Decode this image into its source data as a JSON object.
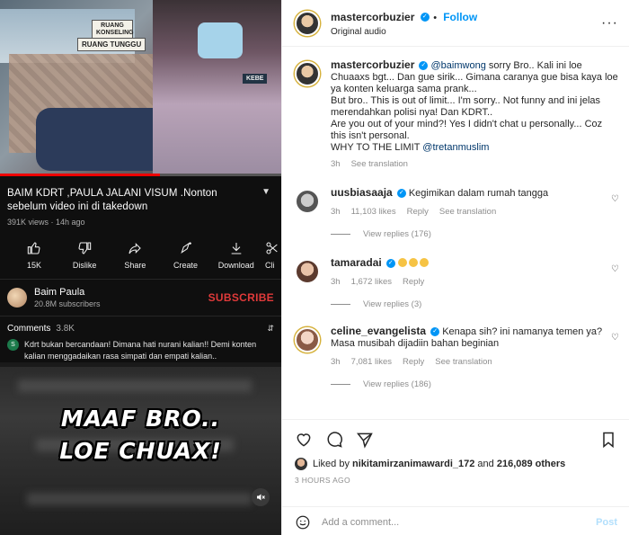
{
  "video": {
    "signs": [
      "RUANG KONSELING",
      "RUANG TUNGGU",
      "KEBE"
    ],
    "title": "BAIM KDRT ,PAULA JALANI VISUM .Nonton sebelum video ini di takedown",
    "meta": "391K views · 14h ago",
    "actions": [
      {
        "label": "15K",
        "icon": "like-icon"
      },
      {
        "label": "Dislike",
        "icon": "dislike-icon"
      },
      {
        "label": "Share",
        "icon": "share-icon"
      },
      {
        "label": "Create",
        "icon": "create-icon"
      },
      {
        "label": "Download",
        "icon": "download-icon"
      },
      {
        "label": "Cli",
        "icon": "clip-icon"
      }
    ],
    "channel": {
      "name": "Baim Paula",
      "subs": "20.8M subscribers",
      "subscribe": "SUBSCRIBE"
    },
    "comments": {
      "label": "Comments",
      "count": "3.8K",
      "top": "Kdrt bukan bercandaan! Dimana hati nurani kalian!! Demi konten kalian menggadaikan rasa simpati dan empati kalian..",
      "avatar_letter": "S"
    },
    "overlay_line1": "MAAF BRO..",
    "overlay_line2": "LOE CHUAX!",
    "progress": 0.57
  },
  "post": {
    "username": "mastercorbuzier",
    "follow": "Follow",
    "audio": "Original audio",
    "caption": {
      "mention": "@baimwong",
      "text1": " sorry Bro.. Kali ini loe Chuaaxs bgt... Dan gue sirik... Gimana caranya gue bisa kaya loe ya konten keluarga sama prank...",
      "text2": "But bro.. This is out of limit... I'm sorry.. Not funny and ini jelas merendahkan polisi nya! Dan KDRT..",
      "text3": "Are you out of your mind?! Yes I didn't chat u personally... Coz this isn't personal.",
      "text4": "WHY TO THE LIMIT ",
      "mention2": "@tretanmuslim",
      "time": "3h",
      "translate": "See translation"
    },
    "comments": [
      {
        "user": "uusbiasaaja",
        "text": "Kegimikan dalam rumah tangga",
        "time": "3h",
        "likes": "11,103 likes",
        "reply": "Reply",
        "translate": "See translation",
        "replies": "View replies (176)"
      },
      {
        "user": "tamaradai",
        "text": "",
        "time": "3h",
        "likes": "1,672 likes",
        "reply": "Reply",
        "replies": "View replies (3)"
      },
      {
        "user": "celine_evangelista",
        "text": "Kenapa sih?  ini namanya temen ya? Masa musibah dijadiin bahan beginian ",
        "time": "3h",
        "likes": "7,081 likes",
        "reply": "Reply",
        "translate": "See translation",
        "replies": "View replies (186)"
      }
    ],
    "liked_by_prefix": "Liked by ",
    "liked_by_user": "nikitamirzanimawardi_172",
    "liked_by_and": " and ",
    "liked_by_count": "216,089 others",
    "time": "3 HOURS AGO",
    "add_comment_placeholder": "Add a comment...",
    "post_label": "Post"
  },
  "colors": {
    "accent": "#0095f6",
    "subscribe": "#e03a3a",
    "progress": "#e00000"
  }
}
